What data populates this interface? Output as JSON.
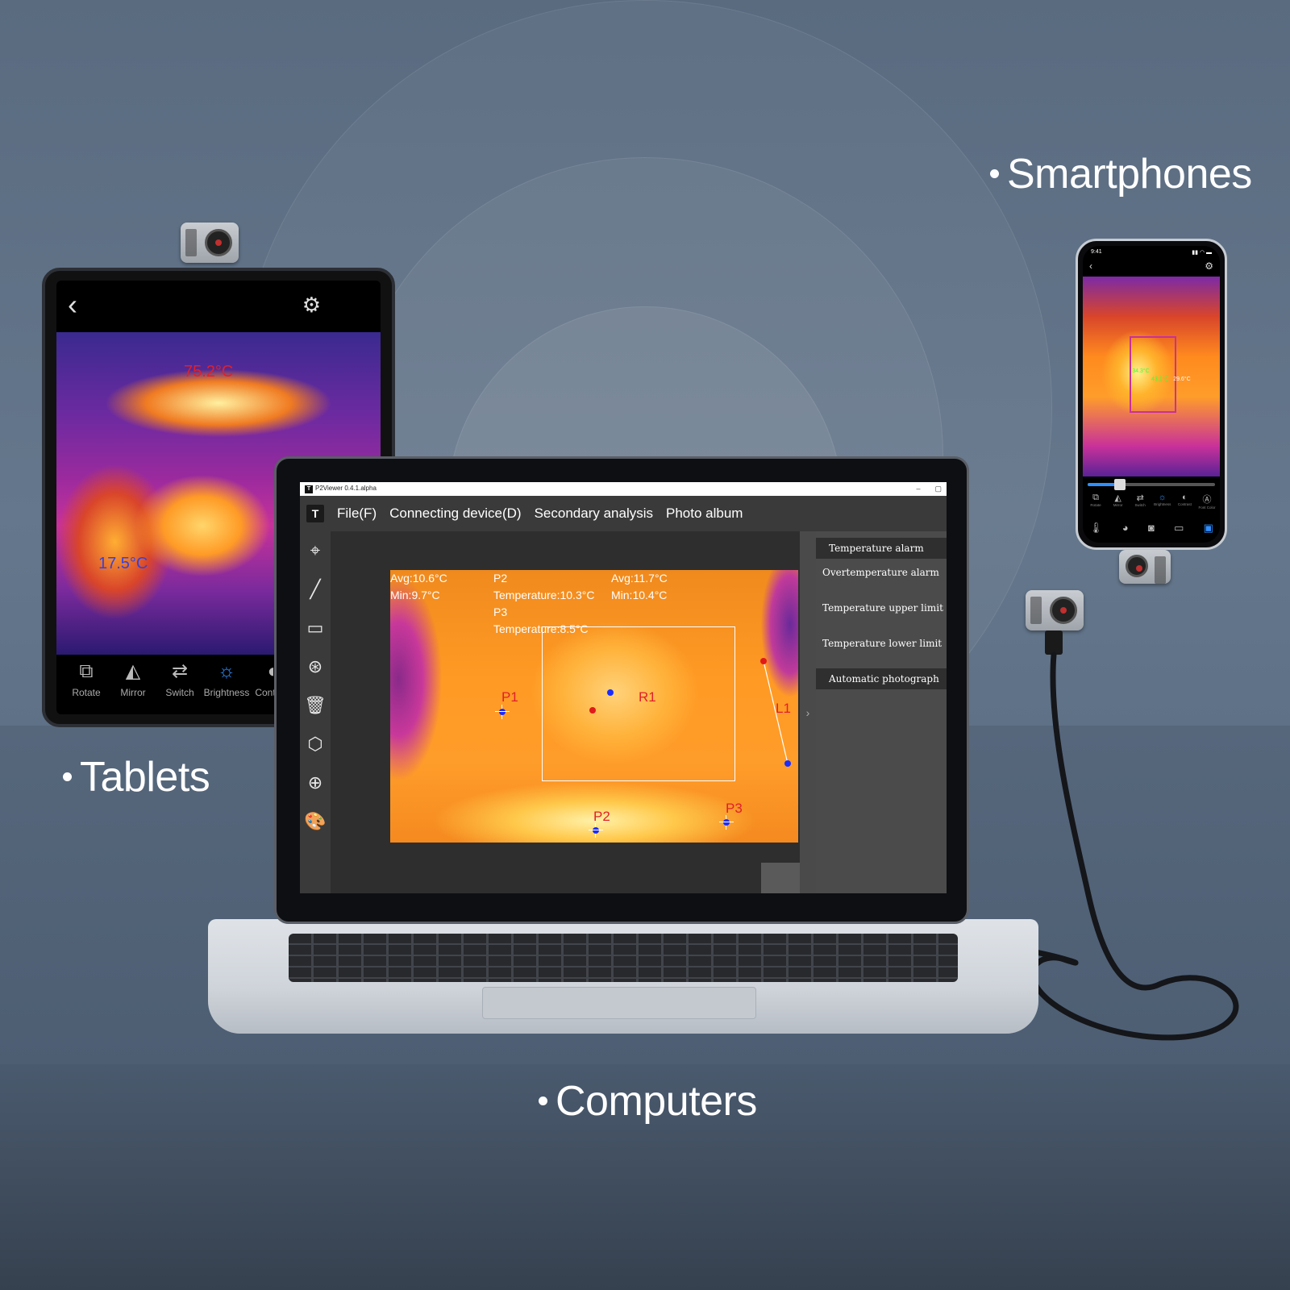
{
  "labels": {
    "smartphones": "Smartphones",
    "tablets": "Tablets",
    "computers": "Computers"
  },
  "tablet": {
    "back_icon": "‹",
    "settings_icon": "⚙",
    "hot_temp": "75.2°C",
    "cold_temp": "17.5°C",
    "tools": [
      {
        "icon": "rotate-icon",
        "glyph": "⧉",
        "label": "Rotate"
      },
      {
        "icon": "mirror-icon",
        "glyph": "◭",
        "label": "Mirror"
      },
      {
        "icon": "switch-icon",
        "glyph": "⇄",
        "label": "Switch"
      },
      {
        "icon": "brightness-icon",
        "glyph": "☼",
        "label": "Brightness",
        "active": true
      },
      {
        "icon": "contrast-icon",
        "glyph": "◐",
        "label": "Contrast"
      }
    ]
  },
  "phone": {
    "time": "9:41",
    "back_icon": "‹",
    "settings_icon": "⚙",
    "readouts": [
      "34.3°C",
      "43.1°C",
      "29.6°C"
    ],
    "slider_value": 0.25,
    "tools": [
      {
        "icon": "rotate-icon",
        "glyph": "⧉",
        "label": "Rotate"
      },
      {
        "icon": "mirror-icon",
        "glyph": "◭",
        "label": "Mirror"
      },
      {
        "icon": "switch-icon",
        "glyph": "⇄",
        "label": "Switch"
      },
      {
        "icon": "brightness-icon",
        "glyph": "☼",
        "label": "Brightness",
        "active": true
      },
      {
        "icon": "contrast-icon",
        "glyph": "◐",
        "label": "Contrast"
      },
      {
        "icon": "font-color-icon",
        "glyph": "Ⓐ",
        "label": "Font Color"
      }
    ],
    "bottom_icons": [
      {
        "icon": "thermometer-icon",
        "glyph": "🌡"
      },
      {
        "icon": "palette-icon",
        "glyph": "◕"
      },
      {
        "icon": "camera-icon",
        "glyph": "◙"
      },
      {
        "icon": "gallery-icon",
        "glyph": "▭"
      },
      {
        "icon": "image-icon",
        "glyph": "▣",
        "active": true
      }
    ]
  },
  "app": {
    "window_title": "P2Viewer 0.4.1.alpha",
    "app_logo": "T",
    "menu": [
      "File(F)",
      "Connecting device(D)",
      "Secondary analysis",
      "Photo album"
    ],
    "tools": [
      {
        "icon": "point-target-icon",
        "glyph": "⌖"
      },
      {
        "icon": "line-tool-icon",
        "glyph": "╱"
      },
      {
        "icon": "rectangle-tool-icon",
        "glyph": "▭"
      },
      {
        "icon": "region-target-icon",
        "glyph": "⊛"
      },
      {
        "icon": "delete-icon",
        "glyph": "🗑"
      },
      {
        "icon": "3d-view-icon",
        "glyph": "⬡"
      },
      {
        "icon": "zoom-in-icon",
        "glyph": "⊕"
      },
      {
        "icon": "palette-icon",
        "glyph": "🎨"
      }
    ],
    "overlay": {
      "left_avg": "Avg:10.6°C",
      "left_min": "Min:9.7°C",
      "p2_label": "P2",
      "p2_temp": "Temperature:10.3°C",
      "p3_label": "P3",
      "p3_temp": "Temperature:8.5°C",
      "right_avg": "Avg:11.7°C",
      "right_min": "Min:10.4°C"
    },
    "markers": {
      "p1": "P1",
      "p2": "P2",
      "p3": "P3",
      "r1": "R1",
      "l1": "L1"
    },
    "collapse_icon": "›",
    "panel": {
      "header": "Temperature alarm",
      "items": [
        "Overtemperature alarm",
        "Temperature upper limit",
        "Temperature lower limit"
      ],
      "footer": "Automatic photograph"
    }
  },
  "colors": {
    "background": "#5f7186",
    "accent_blue": "#2f8fff",
    "hot_red": "#e0202a",
    "cold_blue": "#1a2cff"
  }
}
